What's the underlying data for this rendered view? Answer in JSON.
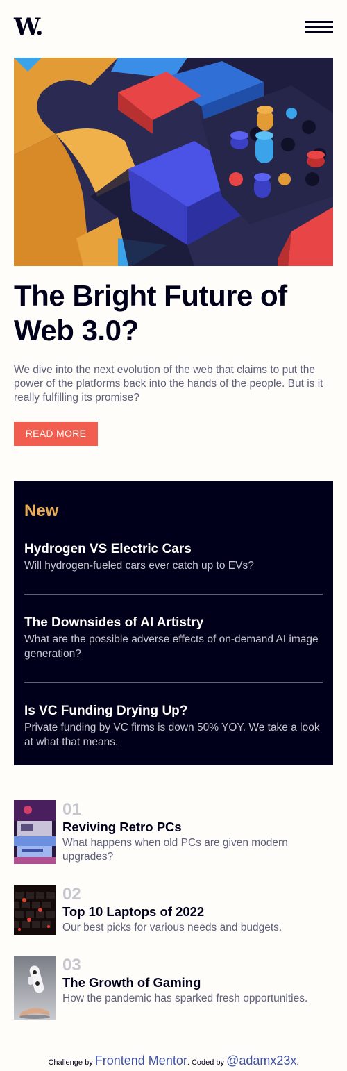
{
  "header": {
    "logo": "W.",
    "menu_icon": "hamburger-menu-icon"
  },
  "hero": {
    "title": "The Bright Future of Web 3.0?",
    "description": "We dive into the next evolution of the web that claims to put the power of the platforms back into the hands of the people. But is it really fulfilling its promise?",
    "button_label": "READ MORE"
  },
  "new": {
    "heading": "New",
    "items": [
      {
        "title": "Hydrogen VS Electric Cars",
        "description": "Will hydrogen-fueled cars ever catch up to EVs?"
      },
      {
        "title": "The Downsides of AI Artistry",
        "description": "What are the possible adverse effects of on-demand AI image generation?"
      },
      {
        "title": "Is VC Funding Drying Up?",
        "description": "Private funding by VC firms is down 50% YOY. We take a look at what that means."
      }
    ]
  },
  "articles": [
    {
      "number": "01",
      "title": "Reviving Retro PCs",
      "description": "What happens when old PCs are given modern upgrades?"
    },
    {
      "number": "02",
      "title": "Top 10 Laptops of 2022",
      "description": "Our best picks for various needs and budgets."
    },
    {
      "number": "03",
      "title": "The Growth of Gaming",
      "description": "How the pandemic has sparked fresh opportunities."
    }
  ],
  "footer": {
    "challenge_prefix": "Challenge by ",
    "challenge_link": "Frontend Mentor",
    "coded_prefix": ". Coded by ",
    "coded_link": "@adamx23x",
    "suffix": "."
  },
  "colors": {
    "accent_red": "#f15e50",
    "accent_orange": "#e9ab53",
    "dark_navy": "#00001a",
    "off_white": "#fffdfa",
    "grayish_blue": "#c5c6ce",
    "dark_grayish_blue": "#5e607a"
  }
}
